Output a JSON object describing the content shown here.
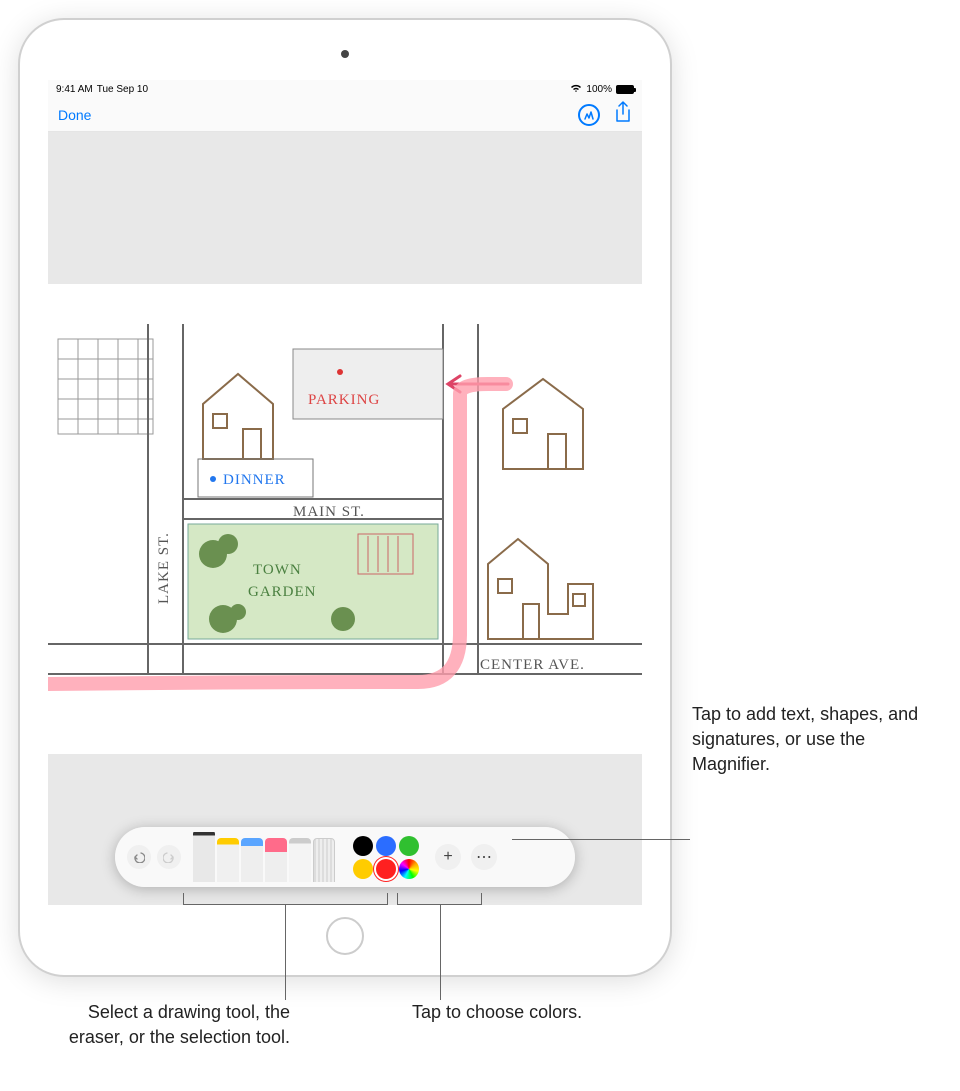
{
  "status": {
    "time": "9:41 AM",
    "date": "Tue Sep 10",
    "battery_pct": "100%"
  },
  "nav": {
    "done": "Done"
  },
  "drawing": {
    "parking": "PARKING",
    "dinner": "DINNER",
    "main_st": "MAIN ST.",
    "town_garden_1": "TOWN",
    "town_garden_2": "GARDEN",
    "lake_st": "LAKE ST.",
    "center_ave": "CENTER AVE."
  },
  "toolbar": {
    "tools": [
      "pen",
      "marker",
      "pencil",
      "eraser",
      "lasso",
      "ruler"
    ],
    "selected_tool": "pen",
    "colors": [
      "black",
      "blue",
      "green",
      "yellow",
      "red",
      "wheel"
    ],
    "selected_color": "red",
    "add_label": "+",
    "more_label": "⋯"
  },
  "callouts": {
    "right": "Tap to add text, shapes, and signatures, or use the Magnifier.",
    "bottom_left": "Select a drawing tool, the eraser, or the selection tool.",
    "bottom_mid": "Tap to choose colors."
  }
}
